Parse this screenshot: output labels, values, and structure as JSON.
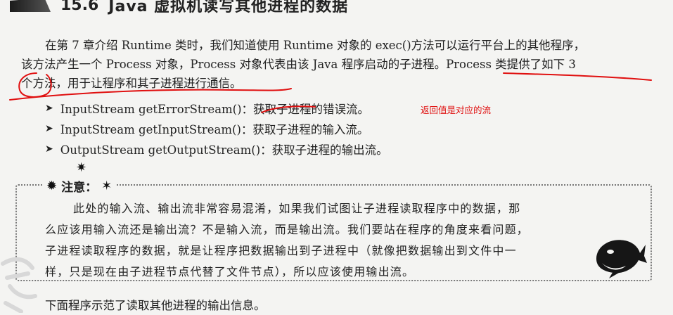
{
  "section": {
    "number": "15.6",
    "title": "Java 虚拟机读写其他进程的数据"
  },
  "intro": {
    "line1": "在第 7 章介绍 Runtime 类时，我们知道使用 Runtime 对象的 exec()方法可以运行平台上的其他程序，",
    "line2": "该方法产生一个 Process 对象，Process 对象代表由该 Java 程序启动的子进程。Process 类提供了如下 3",
    "line3": "个方法，用于让程序和其子进程进行通信。"
  },
  "methods": [
    {
      "text": "InputStream getErrorStream()：获取子进程的错误流。"
    },
    {
      "text": "InputStream getInputStream()：获取子进程的输入流。"
    },
    {
      "text": "OutputStream getOutputStream()：获取子进程的输出流。"
    }
  ],
  "handwritten_note": "返回值是对应的流",
  "notice": {
    "label": "注意：",
    "line1": "此处的输入流、输出流非常容易混淆，如果我们试图让子进程读取程序中的数据，那",
    "line2": "么应该用输入流还是输出流？不是输入流，而是输出流。我们要站在程序的角度来看问题，",
    "line3": "子进程读取程序的数据，就是让程序把数据输出到子进程中（就像把数据输出到文件中一",
    "line4": "样，只是现在由子进程节点代替了文件节点），所以应该使用输出流。"
  },
  "closing": "下面程序示范了读取其他进程的输出信息。",
  "colors": {
    "annotation": "#e01010",
    "text": "#222222"
  }
}
